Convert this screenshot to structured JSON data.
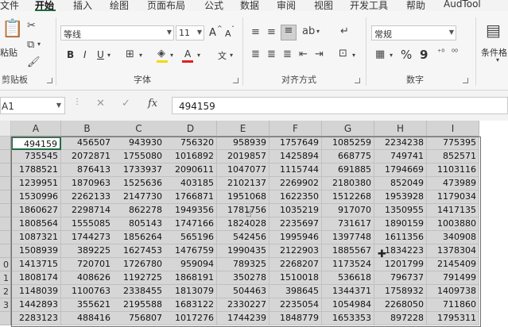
{
  "menu": {
    "tabs": [
      "文件",
      "开始",
      "插入",
      "绘图",
      "页面布局",
      "公式",
      "数据",
      "审阅",
      "视图",
      "开发工具",
      "帮助",
      "AudTool"
    ],
    "active": "开始"
  },
  "ribbon": {
    "clipboard": {
      "paste_label": "粘贴",
      "group_label": "剪贴板"
    },
    "font": {
      "font_name": "等线",
      "font_size": "11",
      "grow_label": "A",
      "shrink_label": "A",
      "bold": "B",
      "italic": "I",
      "underline": "U",
      "font_color_letter": "A",
      "phonetic": "文",
      "group_label": "字体"
    },
    "alignment": {
      "group_label": "对齐方式"
    },
    "number": {
      "format": "常规",
      "percent": "%",
      "comma": "9",
      "group_label": "数字"
    },
    "styles": {
      "conditional_label": "条件格"
    }
  },
  "formula_bar": {
    "name_box": "A1",
    "fx": "fx",
    "value": "494159"
  },
  "grid": {
    "columns": [
      "A",
      "B",
      "C",
      "D",
      "E",
      "F",
      "G",
      "H",
      "I"
    ],
    "row_labels": [
      "",
      "",
      "",
      "",
      "",
      "",
      "",
      "",
      "",
      "0",
      "1",
      "2",
      "3",
      ""
    ],
    "rows": [
      [
        "494159",
        "456507",
        "943930",
        "756320",
        "958939",
        "1757649",
        "1085259",
        "2234238",
        "775395"
      ],
      [
        "735545",
        "2072871",
        "1755080",
        "1016892",
        "2019857",
        "1425894",
        "668775",
        "749741",
        "852571"
      ],
      [
        "1788521",
        "876413",
        "1733937",
        "2090611",
        "1047077",
        "1115744",
        "691885",
        "1794669",
        "1103116"
      ],
      [
        "1239951",
        "1870963",
        "1525636",
        "403185",
        "2102137",
        "2269902",
        "2180380",
        "852049",
        "473989"
      ],
      [
        "1530996",
        "2262133",
        "2147730",
        "1766871",
        "1951068",
        "1622350",
        "1512268",
        "1953928",
        "1179034"
      ],
      [
        "1860627",
        "2298714",
        "862278",
        "1949356",
        "1781756",
        "1035219",
        "917070",
        "1350955",
        "1417135"
      ],
      [
        "1808564",
        "1555085",
        "805143",
        "1747166",
        "1824028",
        "2235697",
        "731617",
        "1890159",
        "1003880"
      ],
      [
        "1087321",
        "1744273",
        "1856264",
        "565196",
        "542456",
        "1995946",
        "1397748",
        "1611356",
        "340908"
      ],
      [
        "1508939",
        "389225",
        "1627453",
        "1476759",
        "1990435",
        "2122903",
        "1885567",
        "1834223",
        "1378304"
      ],
      [
        "1413715",
        "720701",
        "1726780",
        "959094",
        "789325",
        "2268207",
        "1173524",
        "1201799",
        "2145409"
      ],
      [
        "1808174",
        "408626",
        "1192725",
        "1868191",
        "350278",
        "1510018",
        "536618",
        "796737",
        "791499"
      ],
      [
        "1148039",
        "1100763",
        "2338455",
        "1813079",
        "504463",
        "398645",
        "1344371",
        "1758932",
        "1409738"
      ],
      [
        "1442893",
        "355621",
        "2195588",
        "1683122",
        "2330227",
        "2235054",
        "1054984",
        "2268050",
        "711860"
      ],
      [
        "2283123",
        "488416",
        "756807",
        "1017276",
        "1744239",
        "1848779",
        "1653353",
        "897228",
        "1795311"
      ]
    ]
  },
  "colors": {
    "accent": "#1e6e42",
    "selection": "#d6d6d6"
  }
}
